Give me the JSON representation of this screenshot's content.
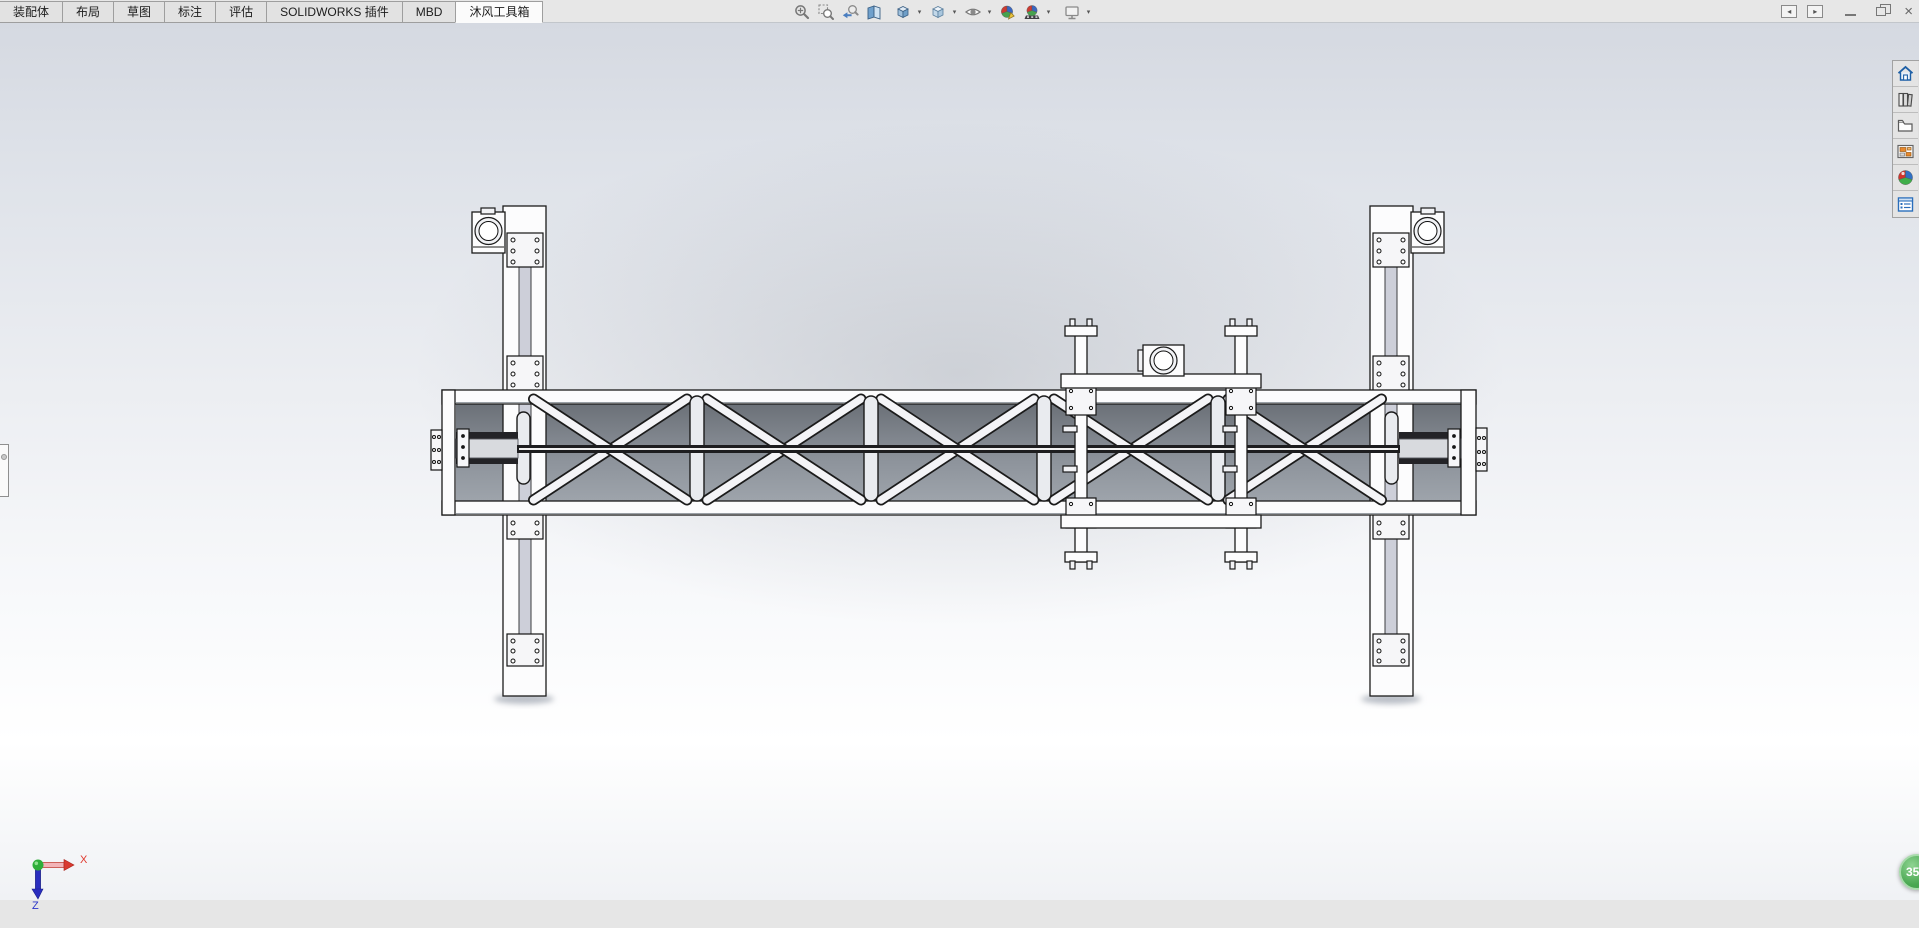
{
  "ribbon_tabs": [
    {
      "label": "装配体"
    },
    {
      "label": "布局"
    },
    {
      "label": "草图"
    },
    {
      "label": "标注"
    },
    {
      "label": "评估"
    },
    {
      "label": "SOLIDWORKS 插件"
    },
    {
      "label": "MBD"
    },
    {
      "label": "沐风工具箱"
    }
  ],
  "active_tab": "沐风工具箱",
  "view_toolbar": {
    "dropdown_glyph": "▾",
    "icons": [
      "zoom-to-fit",
      "zoom-to-area",
      "previous-view",
      "section-view",
      "view-orientation",
      "display-style",
      "hide-show-items",
      "edit-appearance",
      "apply-scene",
      "view-settings"
    ]
  },
  "window_controls": {
    "pane_left_glyph": "◂",
    "pane_right_glyph": "▸",
    "close_glyph": "×"
  },
  "task_pane": {
    "icons": [
      "solidworks-resources",
      "design-library",
      "file-explorer",
      "view-palette",
      "appearances-scenes",
      "custom-properties"
    ]
  },
  "orientation_triad": {
    "x_label": "X",
    "z_label": "Z"
  },
  "notification_badge": {
    "value": "35"
  },
  "colors": {
    "badge_green": "#47a44f",
    "triad_x_red": "#e03a2f",
    "triad_z_blue": "#2b35c8",
    "triad_y_green": "#2fae3a",
    "accent_blue": "#4a7ec0"
  }
}
